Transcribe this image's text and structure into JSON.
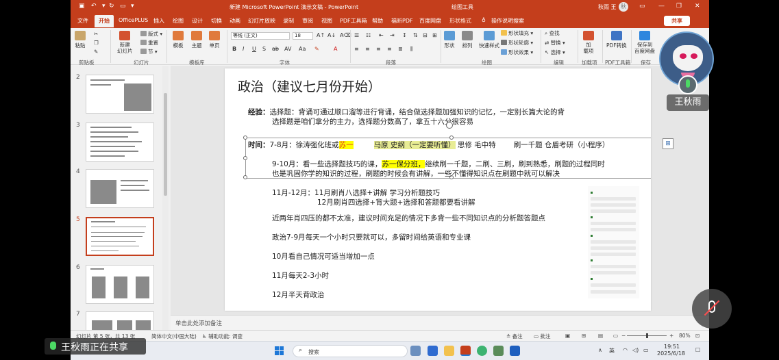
{
  "window": {
    "title": "新建 Microsoft PowerPoint 演示文稿 - PowerPoint",
    "context_label": "绘图工具",
    "user": "秋雨 王",
    "user_avatar": "秋"
  },
  "tabs": [
    {
      "id": "file",
      "label": "文件"
    },
    {
      "id": "home",
      "label": "开始"
    },
    {
      "id": "officeplus",
      "label": "OfficePLUS"
    },
    {
      "id": "insert",
      "label": "插入"
    },
    {
      "id": "draw",
      "label": "绘图"
    },
    {
      "id": "design",
      "label": "设计"
    },
    {
      "id": "transitions",
      "label": "切换"
    },
    {
      "id": "animations",
      "label": "动画"
    },
    {
      "id": "slideshow",
      "label": "幻灯片放映"
    },
    {
      "id": "record",
      "label": "录制"
    },
    {
      "id": "review",
      "label": "审阅"
    },
    {
      "id": "view",
      "label": "视图"
    },
    {
      "id": "pdftools",
      "label": "PDF工具箱"
    },
    {
      "id": "help",
      "label": "帮助"
    },
    {
      "id": "pdf",
      "label": "福昕PDF"
    },
    {
      "id": "baidu",
      "label": "百度网盘"
    },
    {
      "id": "shapeformat",
      "label": "形状格式"
    },
    {
      "id": "tellme",
      "label": "操作说明搜索"
    }
  ],
  "share_label": "共享",
  "ribbon": {
    "paste": "粘贴",
    "new_slide": "新建\n幻灯片",
    "layout": "版式",
    "reset": "重置",
    "section": "节",
    "template": "模板",
    "theme": "主题",
    "single": "单页",
    "font_name": "等线 (正文)",
    "font_size": "18",
    "shape": "形状",
    "arrange": "排列",
    "quick_styles": "快速样式",
    "shape_fill": "形状填充",
    "shape_outline": "形状轮廓",
    "shape_effects": "形状效果",
    "find": "查找",
    "replace": "替换",
    "select": "选择",
    "addin": "加\n载项",
    "pdf_convert": "PDF转换",
    "save_baidu": "保存到\n百度网盘",
    "groups": {
      "clipboard": "剪贴板",
      "slides": "幻灯片",
      "template_lib": "模板库",
      "font": "字体",
      "paragraph": "段落",
      "drawing": "绘图",
      "editing": "编辑",
      "addins": "加载项",
      "pdftools": "PDF工具箱",
      "save": "保存"
    }
  },
  "thumbnails": [
    {
      "num": "2"
    },
    {
      "num": "3"
    },
    {
      "num": "4"
    },
    {
      "num": "5"
    },
    {
      "num": "6"
    },
    {
      "num": "7"
    }
  ],
  "slide": {
    "title": "政治（建议七月份开始）",
    "experience_label": "经验：",
    "experience_line1": "选择题：背诵可通过顺口溜等进行背诵，结合做选择题加强知识的记忆，一定别长篇大论的背",
    "experience_line2": "选择题是咱们拿分的主力，选择题分数高了，拿五十六分很容易",
    "time_label": "时间：",
    "line_78_a": "7-8月：徐涛强化班或",
    "line_78_hl": "苏一",
    "line_78_hl2": "马原 史纲（一定要听懂）",
    "line_78_b": "思修 毛中特",
    "line_78_c": "刷一千题 仓盾考研（小程序）",
    "line_910_a": "9-10月：看一些选择题技巧的课，",
    "line_910_hl": "苏一保分班，",
    "line_910_b": "继续刷一千题，二刷、三刷，刷到熟悉，刷题的过程同时",
    "line_910_c": "也是巩固你学的知识的过程，刷题的时候会有讲解，一些不懂得知识点在刷题中就可以解决",
    "line_1112_a": "11月-12月：11月刷肖八选择+讲解 学习分析题技巧",
    "line_1112_b": "12月刷肖四选择+背大题+选择和答题都要看讲解",
    "line_recent": "近两年肖四压的都不太准，建议时间充足的情况下多背一些不同知识点的分析题答题点",
    "line_79": "政治7-9月每天一个小时只要就可以，多留时间给英语和专业课",
    "line_10": "10月看自己情况可适当增加一点",
    "line_11": "11月每天2-3小时",
    "line_12": "12月半天背政治"
  },
  "notes_placeholder": "单击此处添加备注",
  "status": {
    "slide_count": "幻灯片 第 5 张，共 13 张",
    "language": "简体中文(中国大陆)",
    "accessibility": "辅助功能: 调查",
    "notes": "备注",
    "comments": "批注",
    "zoom": "80%"
  },
  "taskbar": {
    "search": "搜索",
    "ime": "英",
    "time": "19:51",
    "date": "2025/6/18"
  },
  "overlay": {
    "sharer": "王秋雨正在共享",
    "cam_name": "王秋雨"
  }
}
